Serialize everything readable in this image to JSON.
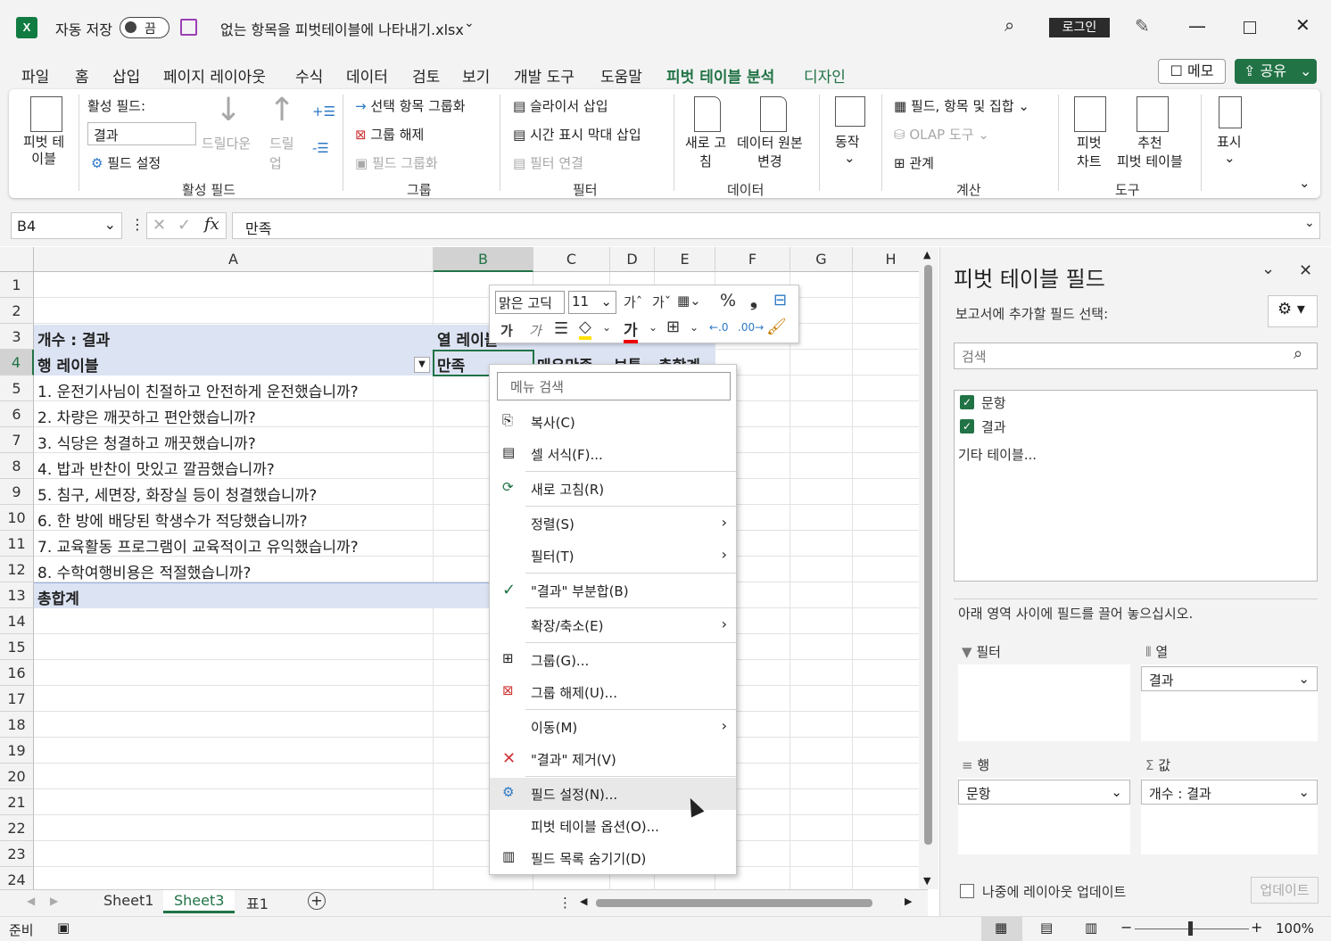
{
  "titlebar": {
    "autosave_label": "자동 저장",
    "autosave_state": "끔",
    "filename": "없는 항목을 피벗테이블에 나타내기.xlsx",
    "login": "로그인"
  },
  "tabs": [
    "파일",
    "홈",
    "삽입",
    "페이지 레이아웃",
    "수식",
    "데이터",
    "검토",
    "보기",
    "개발 도구",
    "도움말",
    "피벗 테이블 분석",
    "디자인"
  ],
  "active_tab": "피벗 테이블 분석",
  "memo_label": "메모",
  "share_label": "공유",
  "ribbon": {
    "pivot_table": "피벗 테\n이블",
    "active_field_label": "활성 필드:",
    "active_field_value": "결과",
    "drill_down": "드릴다운",
    "drill_up": "드릴\n업",
    "field_settings": "필드 설정",
    "group_active_field": "활성 필드",
    "group_selection": "선택 항목 그룹화",
    "ungroup": "그룹 해제",
    "group_field": "필드 그룹화",
    "group_group": "그룹",
    "insert_slicer": "슬라이서 삽입",
    "insert_timeline": "시간 표시 막대 삽입",
    "filter_connections": "필터 연결",
    "group_filter": "필터",
    "refresh": "새로 고\n침",
    "change_source": "데이터 원본\n변경",
    "group_data": "데이터",
    "actions": "동작",
    "fields_items_sets": "필드, 항목 및 집합",
    "olap_tools": "OLAP 도구",
    "relationships": "관계",
    "group_calc": "계산",
    "pivot_chart": "피벗\n차트",
    "recommended": "추천\n피벗 테이블",
    "group_tools": "도구",
    "show": "표시"
  },
  "formula_bar": {
    "name_box": "B4",
    "formula": "만족"
  },
  "columns": [
    "A",
    "B",
    "C",
    "D",
    "E",
    "F",
    "G",
    "H"
  ],
  "rows": [
    "1",
    "2",
    "3",
    "4",
    "5",
    "6",
    "7",
    "8",
    "9",
    "10",
    "11",
    "12",
    "13",
    "14",
    "15",
    "16",
    "17",
    "18",
    "19",
    "20",
    "21",
    "22",
    "23",
    "24"
  ],
  "cells": {
    "a3": "개수 : 결과",
    "b3": "열 레이블",
    "a4": "행 레이블",
    "b4": "만족",
    "c4": "매우만족",
    "d4": "보통",
    "e4": "총합계",
    "items": [
      "1. 운전기사님이 친절하고 안전하게 운전했습니까?",
      "2. 차량은 깨끗하고 편안했습니까?",
      "3. 식당은 청결하고 깨끗했습니까?",
      "4. 밥과 반찬이 맛있고 깔끔했습니까?",
      "5. 침구, 세면장, 화장실 등이 청결했습니까?",
      "6. 한 방에 배당된 학생수가 적당했습니까?",
      "7. 교육활동 프로그램이 교육적이고 유익했습니까?",
      "8. 수학여행비용은 적절했습니까?"
    ],
    "a13": "총합계"
  },
  "mini_toolbar": {
    "font": "맑은 고딕",
    "size": "11",
    "bold": "가",
    "italic": "가",
    "percent": "%",
    "comma": "❟"
  },
  "context_menu": {
    "search_placeholder": "메뉴 검색",
    "items": [
      "복사(C)",
      "셀 서식(F)...",
      "새로 고침(R)",
      "정렬(S)",
      "필터(T)",
      "\"결과\" 부분합(B)",
      "확장/축소(E)",
      "그룹(G)...",
      "그룹 해제(U)...",
      "이동(M)",
      "\"결과\" 제거(V)",
      "필드 설정(N)...",
      "피벗 테이블 옵션(O)...",
      "필드 목록 숨기기(D)"
    ]
  },
  "pane": {
    "title": "피벗 테이블 필드",
    "choose_fields": "보고서에 추가할 필드 선택:",
    "search_placeholder": "검색",
    "fields": [
      "문항",
      "결과"
    ],
    "more_tables": "기타 테이블...",
    "drag_hint": "아래 영역 사이에 필드를 끌어 놓으십시오.",
    "filters": "필터",
    "columns": "열",
    "rows": "행",
    "values": "값",
    "col_field": "결과",
    "row_field": "문항",
    "value_field": "개수 : 결과",
    "defer": "나중에 레이아웃 업데이트",
    "update": "업데이트"
  },
  "sheets": [
    "Sheet1",
    "Sheet3",
    "표1"
  ],
  "active_sheet": "Sheet3",
  "status": {
    "ready": "준비",
    "zoom": "100%"
  },
  "colors": {
    "accent": "#217346",
    "pivot_header": "#dce3f3",
    "selected_cell_border": "#217346"
  }
}
